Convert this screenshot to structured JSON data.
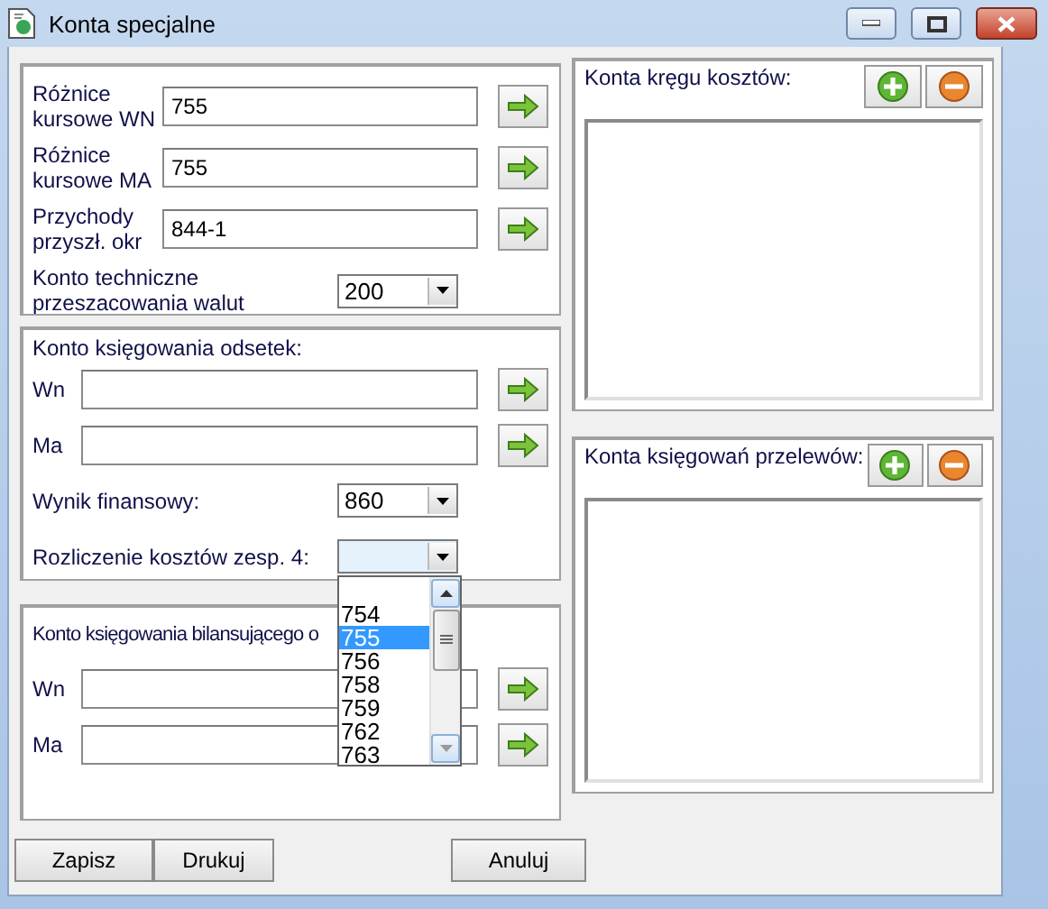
{
  "window": {
    "title": "Konta specjalne"
  },
  "accounts_panel": {
    "rows": [
      {
        "kind": "field",
        "label": "Różnice kursowe WN",
        "value": "755"
      },
      {
        "kind": "field",
        "label": "Różnice kursowe MA",
        "value": "755"
      },
      {
        "kind": "field",
        "label": "Przychody przyszł. okr",
        "value": "844-1"
      },
      {
        "kind": "combo",
        "label": "Konto techniczne przeszacowania walut",
        "value": "200",
        "open": false
      }
    ]
  },
  "interest_panel": {
    "title": "Konto księgowania odsetek:",
    "rows": [
      {
        "kind": "field",
        "label": "Wn"
      },
      {
        "kind": "field",
        "label": "Ma"
      },
      {
        "kind": "combo",
        "label": "Wynik finansowy:",
        "value": "860",
        "open": false
      },
      {
        "kind": "combo",
        "label": "Rozliczenie kosztów zesp. 4:",
        "open": true,
        "options": [
          {
            "label": "754",
            "selected": false
          },
          {
            "label": "755",
            "selected": true
          },
          {
            "label": "756",
            "selected": false
          },
          {
            "label": "758",
            "selected": false
          },
          {
            "label": "759",
            "selected": false
          },
          {
            "label": "762",
            "selected": false
          },
          {
            "label": "763",
            "selected": false
          }
        ]
      }
    ]
  },
  "balancing_panel": {
    "title": "Konto księgowania bilansującego o",
    "rows": [
      {
        "kind": "field",
        "label": "Wn"
      },
      {
        "kind": "field",
        "label": "Ma"
      }
    ]
  },
  "cost_circle_panel": {
    "title": "Konta kręgu kosztów:"
  },
  "transfer_panel": {
    "title": "Konta księgowań przelewów:"
  },
  "buttons": [
    {
      "label": "Zapisz"
    },
    {
      "label": "Drukuj"
    },
    {
      "label": "Anuluj"
    }
  ]
}
